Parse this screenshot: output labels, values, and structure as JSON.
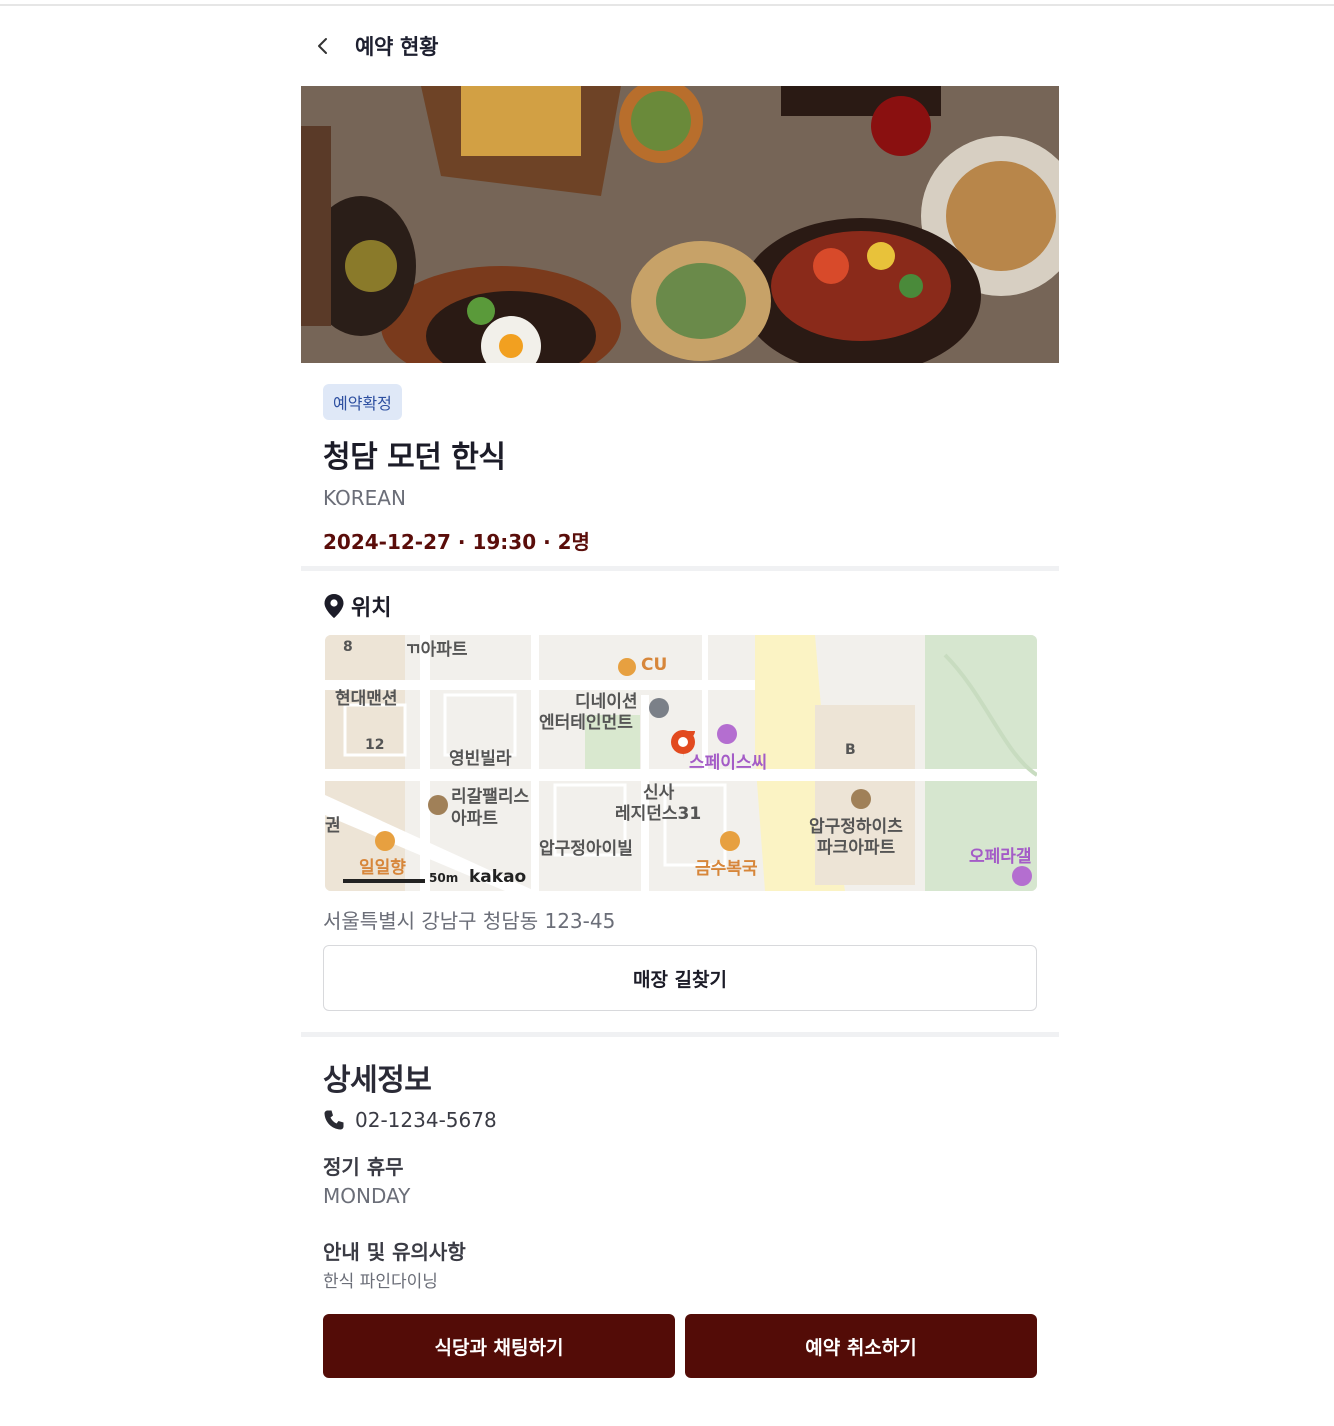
{
  "header": {
    "title": "예약 현황",
    "back_icon": "chevron-left-icon"
  },
  "reservation": {
    "status": "예약확정",
    "restaurant_name": "청담 모던 한식",
    "cuisine": "KOREAN",
    "summary": "2024-12-27 · 19:30 · 2명"
  },
  "location": {
    "title": "위치",
    "icon": "map-pin-icon",
    "address": "서울특별시 강남구 청담동 123-45",
    "directions_label": "매장 길찾기",
    "map_labels": {
      "l1": "8",
      "l2": "ㄲ아파트",
      "l3": "CU",
      "l4": "현대맨션",
      "l5": "디네이션",
      "l6": "엔터테인먼트",
      "l7": "12",
      "l8": "영빈빌라",
      "l9": "스페이스씨",
      "l10": "B",
      "l11": "리갈팰리스",
      "l12": "아파트",
      "l13": "신사",
      "l14": "레지던스31",
      "l15": "압구정하이츠",
      "l16": "파크아파트",
      "l17": "권",
      "l18": "압구정아이빌",
      "l19": "금수복국",
      "l20": "오페라갤",
      "l21": "일일향",
      "l22": "50m",
      "l23": "kakao"
    }
  },
  "details": {
    "title": "상세정보",
    "phone": "02-1234-5678",
    "phone_icon": "phone-icon",
    "closed_label": "정기 휴무",
    "closed_value": "MONDAY",
    "notice_label": "안내 및 유의사항",
    "notice_value": "한식 파인다이닝"
  },
  "actions": {
    "chat_label": "식당과 채팅하기",
    "cancel_label": "예약 취소하기"
  },
  "colors": {
    "primary": "#530c07",
    "badge_bg": "#dfe8f7",
    "badge_text": "#2d4fa0",
    "summary_text": "#5a0d0a"
  }
}
